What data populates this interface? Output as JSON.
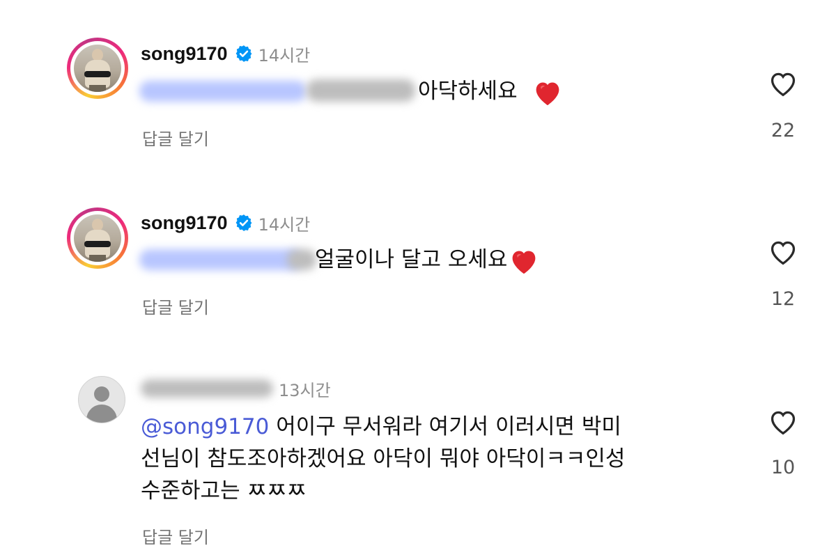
{
  "comments": [
    {
      "username": "song9170",
      "verified": true,
      "time": "14시간",
      "text": "아닥하세요",
      "reply_label": "답글 달기",
      "likes": "22"
    },
    {
      "username": "song9170",
      "verified": true,
      "time": "14시간",
      "text": "얼굴이나 달고 오세요",
      "reply_label": "답글 달기",
      "likes": "12"
    },
    {
      "username": "",
      "verified": false,
      "time": "13시간",
      "mention": "@song9170",
      "line1": "어이구 무서워라 여기서 이러시면 박미",
      "line2": "선님이 참도조아하겠어요 아닥이 뭐야 아닥이ㅋㅋ인성",
      "line3": "수준하고는 ㅉㅉㅉ",
      "reply_label": "답글 달기",
      "likes": "10"
    }
  ],
  "icons": {
    "verified": "verified-badge-icon",
    "like": "heart-outline-icon",
    "emoji": "red-heart-emoji",
    "default_avatar": "default-avatar-icon"
  },
  "colors": {
    "verified": "#0095f6",
    "mention": "#4a5bd6",
    "emoji_heart": "#e0262f",
    "secondary_text": "#8e8e8e"
  }
}
